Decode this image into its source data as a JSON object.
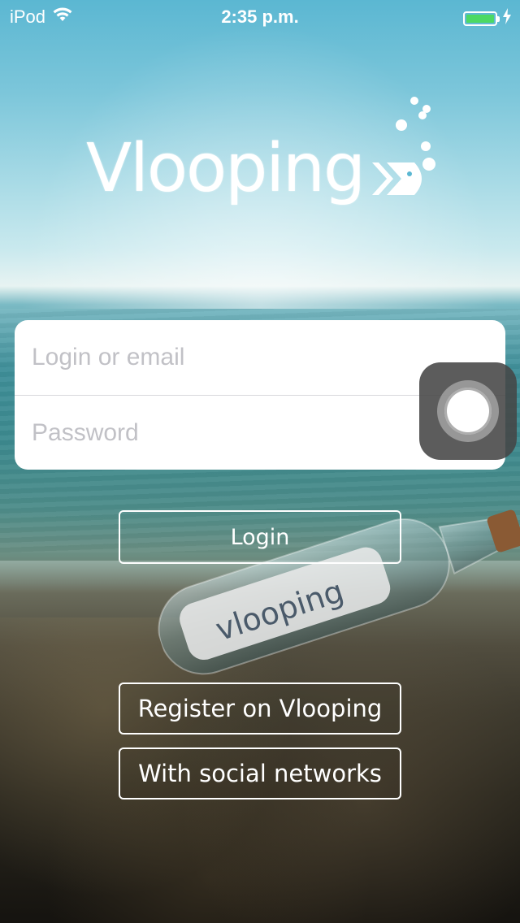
{
  "status_bar": {
    "carrier": "iPod",
    "time": "2:35 p.m.",
    "battery_level": 1.0,
    "battery_color": "#4cd964",
    "icons": [
      "wifi-icon",
      "battery-icon",
      "charging-icon"
    ]
  },
  "logo": {
    "text": "Vlooping"
  },
  "form": {
    "login_placeholder": "Login or email",
    "login_value": "",
    "password_placeholder": "Password",
    "password_value": ""
  },
  "buttons": {
    "login": "Login",
    "register": "Register on Vlooping",
    "social": "With social networks"
  },
  "overlay": {
    "assistive_touch_icon": "assistive-touch-icon"
  },
  "colors": {
    "sky": "#5bb7d2",
    "sea": "#3d8a8f",
    "button_border": "#ffffff"
  }
}
